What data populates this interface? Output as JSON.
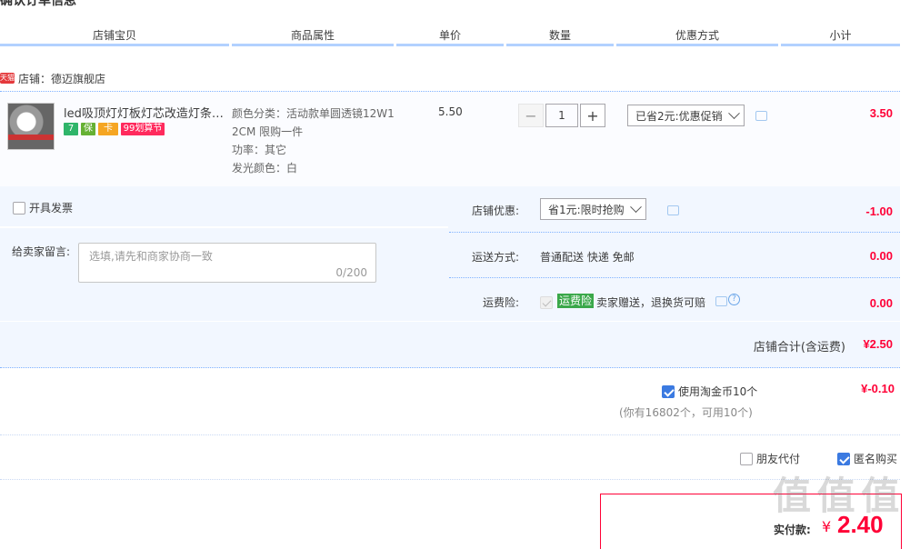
{
  "page_title": "确认订单信息",
  "header": {
    "shop_item": "店铺宝贝",
    "attrs": "商品属性",
    "unit_price": "单价",
    "quantity": "数量",
    "discount": "优惠方式",
    "subtotal": "小计"
  },
  "shop": {
    "badge": "天猫",
    "label": "店铺：德迈旗舰店"
  },
  "item": {
    "title": "led吸顶灯灯板灯芯改造灯条灯...",
    "badges": [
      "7",
      "保",
      "卡",
      "99划算节"
    ],
    "attr_lines": [
      "颜色分类：活动款单圆透镜12W1",
      "2CM 限购一件",
      "功率：其它",
      "发光颜色：白"
    ],
    "price": "5.50",
    "quantity": "1",
    "minus": "−",
    "plus": "+",
    "discount_selected": "已省2元:优惠促销",
    "subtotal": "3.50"
  },
  "options": {
    "invoice_label": "开具发票",
    "message_label": "给卖家留言:",
    "message_placeholder": "选填,请先和商家协商一致",
    "message_count": "0/200",
    "shop_discount_label": "店铺优惠:",
    "shop_discount_selected": "省1元:限时抢购",
    "shop_discount_value": "-1.00",
    "shipping_label": "运送方式:",
    "shipping_value": "普通配送 快递 免邮",
    "shipping_price": "0.00",
    "insurance_label": "运费险:",
    "insurance_tag": "运费险",
    "insurance_text": "卖家赠送，退换货可赔",
    "insurance_price": "0.00",
    "help_icon": "?"
  },
  "shop_total": {
    "label": "店铺合计(含运费)",
    "value": "¥2.50"
  },
  "coins": {
    "label": "使用淘金币10个",
    "value": "¥-0.10",
    "note": "(你有16802个，可用10个)"
  },
  "payment_options": {
    "friend_pay": "朋友代付",
    "anonymous": "匿名购买"
  },
  "pay": {
    "label": "实付款:",
    "currency": "¥",
    "amount": "2.40"
  },
  "watermark": "值 值 值",
  "colors": {
    "accent": "#ff0036",
    "border": "#b2d1ff",
    "option_bg": "#f2f7ff",
    "check": "#3b7ae1"
  }
}
